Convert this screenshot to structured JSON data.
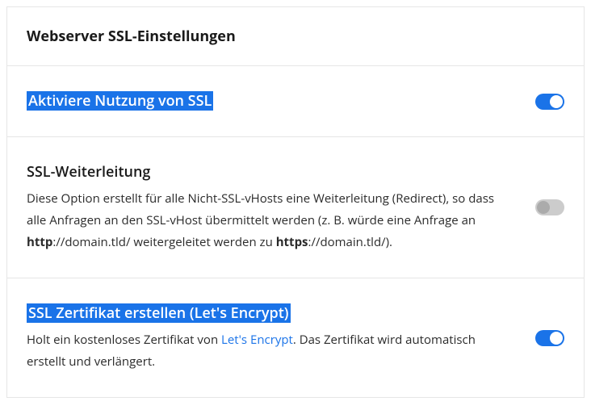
{
  "header": {
    "title": "Webserver SSL-Einstellungen"
  },
  "settings": {
    "enable_ssl": {
      "title": "Aktiviere Nutzung von SSL",
      "enabled": true,
      "highlighted": true
    },
    "ssl_redirect": {
      "title": "SSL-Weiterleitung",
      "desc_before": "Diese Option erstellt für alle Nicht-SSL-vHosts eine Weiterleitung (Redirect), so dass alle Anfragen an den SSL-vHost übermittelt werden (z. B. würde eine Anfrage an ",
      "desc_bold1": "http",
      "desc_mid": "://domain.tld/ weitergeleitet werden zu ",
      "desc_bold2": "https",
      "desc_after": "://domain.tld/).",
      "enabled": false,
      "highlighted": false
    },
    "lets_encrypt": {
      "title": "SSL Zertifikat erstellen (Let's Encrypt)",
      "desc_before": "Holt ein kostenloses Zertifikat von ",
      "link_text": "Let's Encrypt",
      "desc_after": ". Das Zertifikat wird automatisch erstellt und verlängert.",
      "enabled": true,
      "highlighted": true
    }
  }
}
